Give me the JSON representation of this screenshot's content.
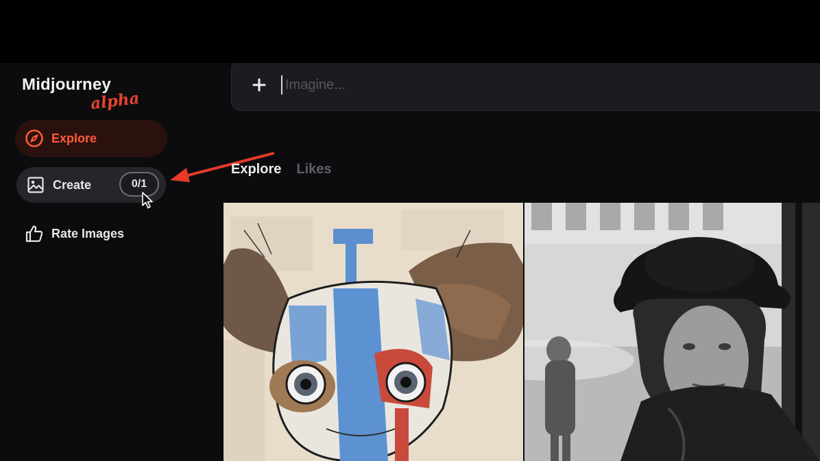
{
  "app": {
    "logo_main": "Midjourney",
    "logo_sub": "alpha"
  },
  "sidebar": {
    "items": [
      {
        "label": "Explore",
        "icon": "compass-icon",
        "active": true
      },
      {
        "label": "Create",
        "icon": "image-icon",
        "badge": "0/1"
      },
      {
        "label": "Rate Images",
        "icon": "thumbs-up-icon"
      }
    ]
  },
  "prompt": {
    "placeholder": "Imagine...",
    "add_icon": "plus-icon"
  },
  "tabs": [
    {
      "label": "Explore",
      "active": true
    },
    {
      "label": "Likes",
      "active": false
    }
  ],
  "colors": {
    "accent": "#ff5b3a",
    "annotation_arrow": "#e8392a",
    "background": "#0c0c0e"
  }
}
